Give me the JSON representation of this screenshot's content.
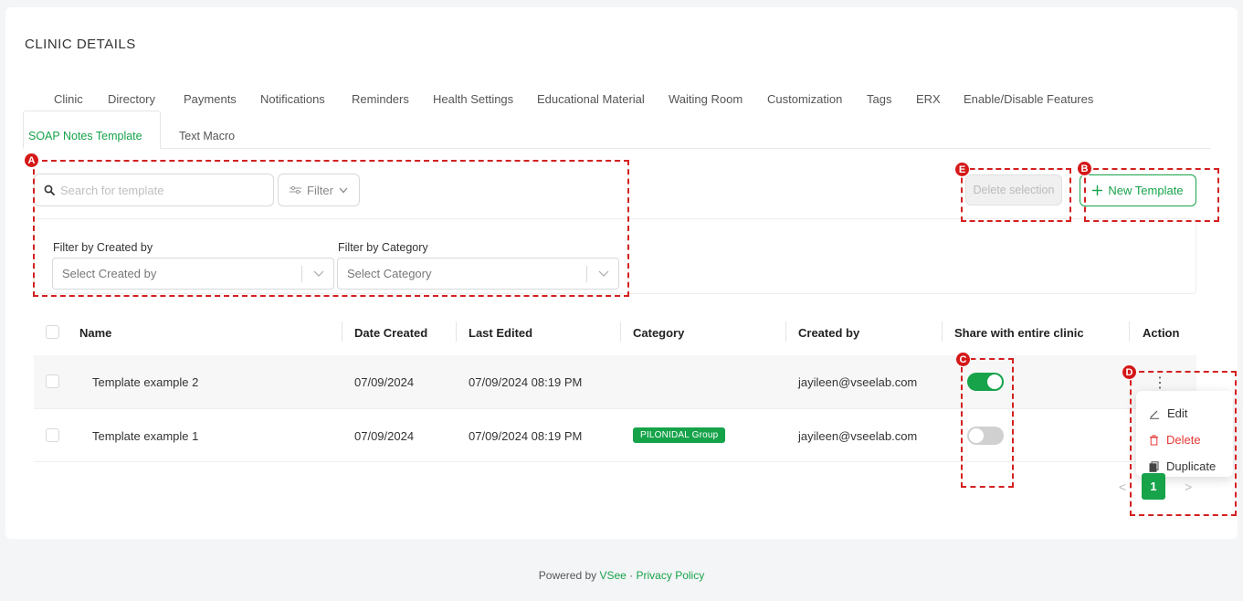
{
  "page": {
    "title": "CLINIC DETAILS"
  },
  "tabs": [
    "Clinic",
    "Directory",
    "Payments",
    "Notifications",
    "Reminders",
    "Health Settings",
    "Educational Material",
    "Waiting Room",
    "Customization",
    "Tags",
    "ERX",
    "Enable/Disable Features"
  ],
  "subtabs": [
    "SOAP Notes Template",
    "Text Macro"
  ],
  "toolbar": {
    "search_placeholder": "Search for template",
    "filter_label": "Filter",
    "delete_label": "Delete selection",
    "new_label": "New Template"
  },
  "filters": {
    "created_by_label": "Filter by Created by",
    "created_by_placeholder": "Select Created by",
    "category_label": "Filter by Category",
    "category_placeholder": "Select Category"
  },
  "table": {
    "headers": [
      "Name",
      "Date Created",
      "Last Edited",
      "Category",
      "Created by",
      "Share with entire clinic",
      "Action"
    ],
    "rows": [
      {
        "name": "Template example 2",
        "date_created": "07/09/2024",
        "last_edited": "07/09/2024 08:19 PM",
        "category": "",
        "created_by": "jayileen@vseelab.com",
        "shared": true
      },
      {
        "name": "Template example 1",
        "date_created": "07/09/2024",
        "last_edited": "07/09/2024 08:19 PM",
        "category": "PILONIDAL Group",
        "created_by": "jayileen@vseelab.com",
        "shared": false
      }
    ]
  },
  "action_menu": {
    "edit": "Edit",
    "delete": "Delete",
    "duplicate": "Duplicate"
  },
  "pagination": {
    "current": "1",
    "prev": "<",
    "next": ">"
  },
  "annotations": [
    "A",
    "B",
    "C",
    "D",
    "E"
  ],
  "footer": {
    "prefix": "Powered by ",
    "brand": "VSee",
    "sep": " · ",
    "privacy": "Privacy Policy"
  },
  "colors": {
    "accent": "#16a34a",
    "annotation": "#d32020",
    "delete": "#e53935"
  },
  "icons": {
    "search": "search-icon",
    "filter": "sliders-icon",
    "chevron": "chevron-down-icon",
    "plus": "plus-icon",
    "kebab": "kebab-icon",
    "edit": "pencil-icon",
    "delete": "trash-icon",
    "duplicate": "copy-icon"
  }
}
